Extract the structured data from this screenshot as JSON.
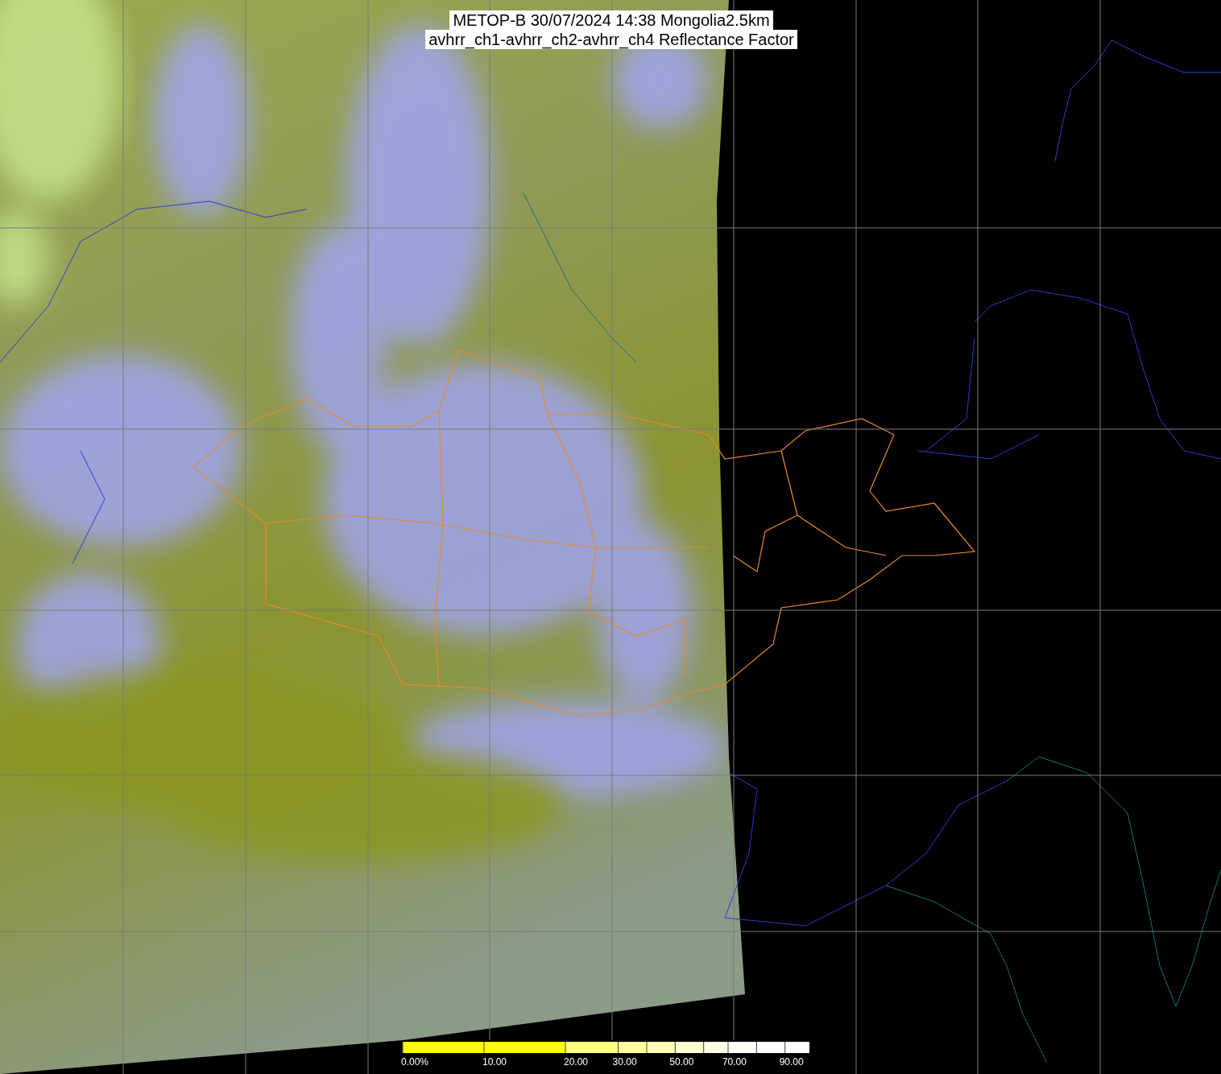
{
  "title": {
    "line_1": "METOP-B 30/07/2024 14:38 Mongolia2.5km",
    "line_2": "avhrr_ch1-avhrr_ch2-avhrr_ch4 Reflectance Factor"
  },
  "colorbar": {
    "labels": [
      "0.00%",
      "10.00",
      "20.00",
      "30.00",
      "50.00",
      "70.00",
      "90.00"
    ]
  }
}
